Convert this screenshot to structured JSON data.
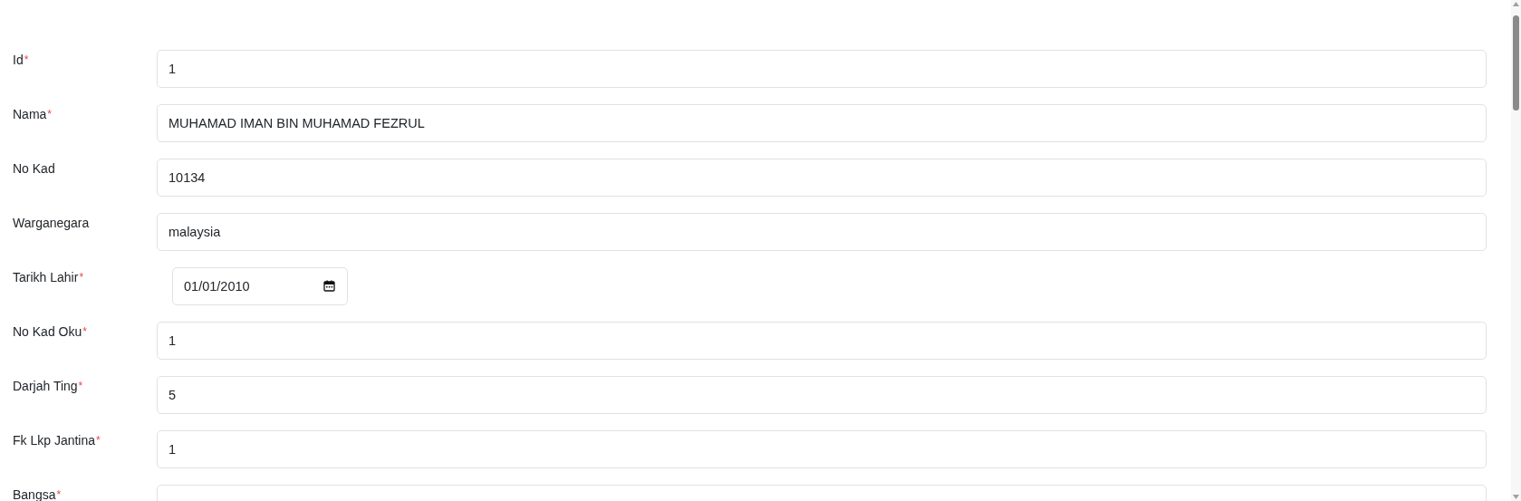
{
  "form": {
    "fields": [
      {
        "label": "Id",
        "required_mark": "*",
        "kind": "text",
        "value": "1"
      },
      {
        "label": "Nama",
        "required_mark": "*",
        "kind": "text",
        "value": "MUHAMAD IMAN BIN MUHAMAD FEZRUL"
      },
      {
        "label": "No Kad",
        "kind": "text",
        "value": "10134"
      },
      {
        "label": "Warganegara",
        "kind": "text",
        "value": "malaysia"
      },
      {
        "label": "Tarikh Lahir",
        "required_mark": "*",
        "kind": "date",
        "value": "01/01/2010"
      },
      {
        "label": "No Kad Oku",
        "required_mark": "*",
        "kind": "text",
        "value": "1"
      },
      {
        "label": "Darjah Ting",
        "required_mark": "*",
        "kind": "text",
        "value": "5"
      },
      {
        "label": "Fk Lkp Jantina",
        "required_mark": "*",
        "kind": "text",
        "value": "1"
      },
      {
        "label": "Bangsa",
        "required_mark": "*",
        "kind": "text"
      }
    ]
  }
}
